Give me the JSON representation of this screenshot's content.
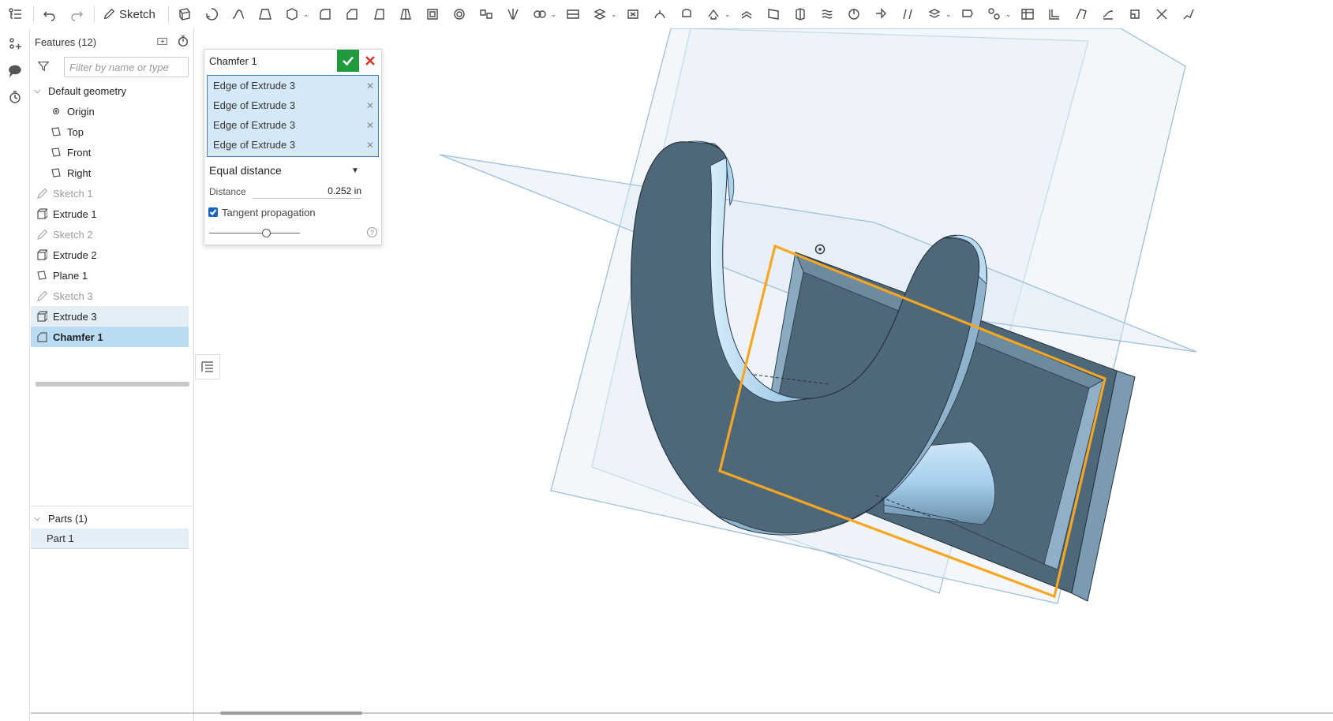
{
  "toolbar": {
    "sketch_label": "Sketch",
    "icons": [
      "undo-icon",
      "redo-icon",
      "sketch-pencil-icon",
      "extrude-icon",
      "revolve-icon",
      "sweep-icon",
      "loft-icon",
      "thicken-icon",
      "fillet-icon",
      "chamfer-icon",
      "draft-icon",
      "rib-icon",
      "shell-icon",
      "hole-icon",
      "linear-pattern-icon",
      "mirror-icon",
      "boolean-icon",
      "split-icon",
      "transform-icon",
      "delete-part-icon",
      "modify-fillet-icon",
      "delete-face-icon",
      "move-face-icon",
      "replace-face-icon",
      "plane-icon",
      "mate-connector-icon",
      "helix-icon",
      "fit-spline-icon",
      "variable-icon",
      "variable-table-icon",
      "sheet-metal-icon",
      "frame-icon",
      "surface-icon",
      "bend-icon",
      "flange-icon",
      "hem-icon",
      "tab-icon",
      "corner-icon",
      "break-icon",
      "table-icon"
    ]
  },
  "left_strip": {
    "icons": [
      "feature-list-icon",
      "add-part-icon",
      "comment-icon",
      "history-icon"
    ]
  },
  "feature_panel": {
    "title": "Features (12)",
    "filter_placeholder": "Filter by name or type",
    "default_geometry_label": "Default geometry",
    "items": [
      {
        "label": "Origin",
        "kind": "origin",
        "state": "normal"
      },
      {
        "label": "Top",
        "kind": "plane",
        "state": "normal"
      },
      {
        "label": "Front",
        "kind": "plane",
        "state": "normal"
      },
      {
        "label": "Right",
        "kind": "plane",
        "state": "normal"
      },
      {
        "label": "Sketch 1",
        "kind": "sketch",
        "state": "dim"
      },
      {
        "label": "Extrude 1",
        "kind": "extrude",
        "state": "normal"
      },
      {
        "label": "Sketch 2",
        "kind": "sketch",
        "state": "dim"
      },
      {
        "label": "Extrude 2",
        "kind": "extrude",
        "state": "normal"
      },
      {
        "label": "Plane 1",
        "kind": "plane",
        "state": "normal"
      },
      {
        "label": "Sketch 3",
        "kind": "sketch",
        "state": "dim"
      },
      {
        "label": "Extrude 3",
        "kind": "extrude",
        "state": "hover"
      },
      {
        "label": "Chamfer 1",
        "kind": "chamfer",
        "state": "selected"
      }
    ],
    "parts_header": "Parts (1)",
    "parts": [
      "Part 1"
    ]
  },
  "dialog": {
    "title": "Chamfer 1",
    "edges": [
      "Edge of Extrude 3",
      "Edge of Extrude 3",
      "Edge of Extrude 3",
      "Edge of Extrude 3"
    ],
    "type_value": "Equal distance",
    "distance_label": "Distance",
    "distance_value": "0.252 in",
    "tangent_label": "Tangent propagation",
    "tangent_checked": true,
    "slider_value": 0.63
  },
  "colors": {
    "accent": "#1f9a3c",
    "selection": "#b9dcf3",
    "highlight_edge": "#f5a623",
    "part_fill": "#4c6476",
    "part_face_light": "#a9d3ee"
  }
}
